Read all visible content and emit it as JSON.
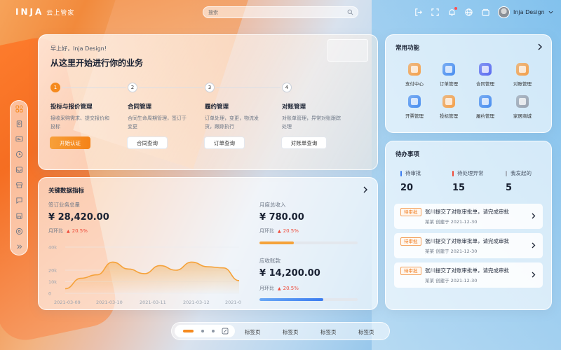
{
  "brand": {
    "logo": "INJA",
    "name": "云上管家"
  },
  "search": {
    "placeholder": "搜索"
  },
  "user": {
    "name": "Inja Design"
  },
  "welcome": {
    "greeting": "早上好，Inja Design!",
    "headline": "从这里开始进行你的业务",
    "steps": [
      {
        "num": "1",
        "title": "投标与报价管理",
        "desc": "接收采购需求、提交报价和投标",
        "button": "开始认证"
      },
      {
        "num": "2",
        "title": "合同管理",
        "desc": "合同生命周期管理，签订于变更",
        "button": "合同查询"
      },
      {
        "num": "3",
        "title": "履约管理",
        "desc": "订单处理，变更，物流发货，跟踪执行",
        "button": "订单查询"
      },
      {
        "num": "4",
        "title": "对账管理",
        "desc": "对账单管理，异常对账跟踪处理",
        "button": "对账单查询"
      }
    ]
  },
  "keydata": {
    "title": "关键数据指标",
    "total": {
      "label": "签订业务总量",
      "value": "¥ 28,420.00",
      "change_label": "月环比",
      "change": "20.5%"
    },
    "monthly": {
      "label": "月度总收入",
      "value": "¥ 780.00",
      "change_label": "月环比",
      "change": "20.5%",
      "progress": 0.35
    },
    "receivable": {
      "label": "应收账款",
      "value": "¥ 14,200.00",
      "change_label": "月环比",
      "change": "20.5%",
      "progress": 0.65
    }
  },
  "chart_data": {
    "type": "area",
    "x": [
      "2021-03-09",
      "",
      "",
      "2021-03-10",
      "",
      "",
      "2021-03-11",
      "",
      "",
      "2021-03-12",
      "",
      "2021-0"
    ],
    "values": [
      4,
      13,
      16,
      27,
      21,
      17,
      24,
      20,
      27,
      23,
      22,
      11
    ],
    "y_ticks": [
      "40k",
      "20k",
      "10k",
      "0"
    ],
    "x_ticks": [
      "2021-03-09",
      "2021-03-10",
      "2021-03-11",
      "2021-03-12",
      "2021-0"
    ],
    "ylim": [
      0,
      40
    ],
    "color": "#f5a23a"
  },
  "common": {
    "title": "常用功能",
    "items": [
      {
        "label": "支付中心",
        "icon": "payment-icon",
        "color": "#f5a04a"
      },
      {
        "label": "订单管理",
        "icon": "order-icon",
        "color": "#4a8ef0"
      },
      {
        "label": "合同管理",
        "icon": "contract-icon",
        "color": "#5b6bf0"
      },
      {
        "label": "对账管理",
        "icon": "reconcile-icon",
        "color": "#f5a04a"
      },
      {
        "label": "开票管理",
        "icon": "invoice-icon",
        "color": "#4a8ef0"
      },
      {
        "label": "投标管理",
        "icon": "bid-icon",
        "color": "#f5a04a"
      },
      {
        "label": "履约管理",
        "icon": "fulfillment-icon",
        "color": "#4a8ef0"
      },
      {
        "label": "家居商城",
        "icon": "mall-icon",
        "color": "#9aa3b0"
      }
    ]
  },
  "todo": {
    "title": "待办事项",
    "stats": [
      {
        "label": "待审批",
        "num": "20",
        "color": "#3b7cf0"
      },
      {
        "label": "待处理异常",
        "num": "15",
        "color": "#ef4b3a"
      },
      {
        "label": "我发起的",
        "num": "5",
        "color": "#a8b0bb"
      }
    ],
    "items": [
      {
        "tag": "待审批",
        "text": "张川提交了对账审批单，请完成审批",
        "meta": "某某  创建于 2021-12-30"
      },
      {
        "tag": "待审批",
        "text": "张川提交了对账审批单，请完成审批",
        "meta": "某某  创建于 2021-12-30"
      },
      {
        "tag": "待审批",
        "text": "张川提交了对账审批单，请完成审批",
        "meta": "某某  创建于 2021-12-30"
      }
    ]
  },
  "tabbar": {
    "tabs": [
      "标签页",
      "标签页",
      "标签页",
      "标签页"
    ]
  }
}
